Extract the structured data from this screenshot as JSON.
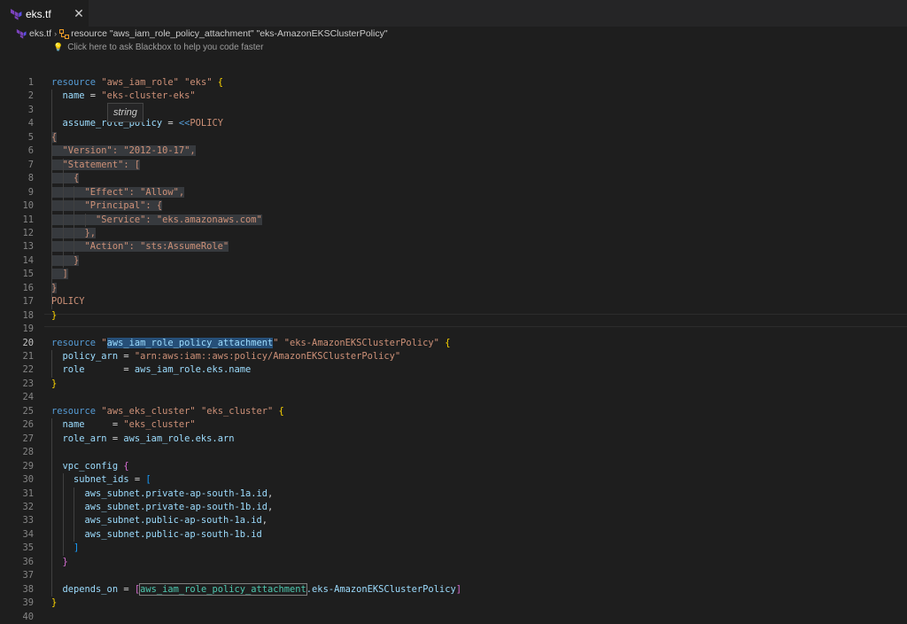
{
  "tab": {
    "label": "eks.tf",
    "close": "✕"
  },
  "breadcrumb": {
    "file": "eks.tf",
    "separator": "›",
    "resource": "resource \"aws_iam_role_policy_attachment\" \"eks-AmazonEKSClusterPolicy\""
  },
  "hint": {
    "text": "Click here to ask Blackbox to help you code faster"
  },
  "tooltip": {
    "text": "string"
  },
  "editor": {
    "active_line": 20,
    "lines": [
      [
        [
          "kw",
          "resource "
        ],
        [
          "str",
          "\"aws_iam_role\""
        ],
        [
          "t",
          " "
        ],
        [
          "str",
          "\"eks\""
        ],
        [
          "t",
          " "
        ],
        [
          "br1",
          "{"
        ]
      ],
      [
        [
          "t",
          "  "
        ],
        [
          "id",
          "name"
        ],
        [
          "t",
          " = "
        ],
        [
          "str",
          "\"eks-cluster-eks\""
        ]
      ],
      [],
      [
        [
          "t",
          "  "
        ],
        [
          "id",
          "assume_role_policy"
        ],
        [
          "t",
          " = "
        ],
        [
          "kw",
          "<<"
        ],
        [
          "str",
          "POLICY"
        ]
      ],
      [
        [
          "str",
          "{"
        ]
      ],
      [
        [
          "str",
          "  \"Version\": \"2012-10-17\","
        ]
      ],
      [
        [
          "str",
          "  \"Statement\": ["
        ]
      ],
      [
        [
          "str",
          "    {"
        ]
      ],
      [
        [
          "str",
          "      \"Effect\": \"Allow\","
        ]
      ],
      [
        [
          "str",
          "      \"Principal\": {"
        ]
      ],
      [
        [
          "str",
          "        \"Service\": \"eks.amazonaws.com\""
        ]
      ],
      [
        [
          "str",
          "      },"
        ]
      ],
      [
        [
          "str",
          "      \"Action\": \"sts:AssumeRole\""
        ]
      ],
      [
        [
          "str",
          "    }"
        ]
      ],
      [
        [
          "str",
          "  ]"
        ]
      ],
      [
        [
          "str",
          "}"
        ]
      ],
      [
        [
          "str",
          "POLICY"
        ]
      ],
      [
        [
          "br1",
          "}"
        ]
      ],
      [],
      [
        [
          "kw",
          "resource "
        ],
        [
          "str",
          "\""
        ],
        [
          "sel",
          "aws_iam_role_policy_attachment"
        ],
        [
          "str",
          "\""
        ],
        [
          "t",
          " "
        ],
        [
          "str",
          "\"eks-AmazonEKSClusterPolicy\""
        ],
        [
          "t",
          " "
        ],
        [
          "br1",
          "{"
        ]
      ],
      [
        [
          "t",
          "  "
        ],
        [
          "id",
          "policy_arn"
        ],
        [
          "t",
          " = "
        ],
        [
          "str",
          "\"arn:aws:iam::aws:policy/AmazonEKSClusterPolicy\""
        ]
      ],
      [
        [
          "t",
          "  "
        ],
        [
          "id",
          "role"
        ],
        [
          "t",
          "       = "
        ],
        [
          "id",
          "aws_iam_role.eks.name"
        ]
      ],
      [
        [
          "br1",
          "}"
        ]
      ],
      [],
      [
        [
          "kw",
          "resource "
        ],
        [
          "str",
          "\"aws_eks_cluster\""
        ],
        [
          "t",
          " "
        ],
        [
          "str",
          "\"eks_cluster\""
        ],
        [
          "t",
          " "
        ],
        [
          "br1",
          "{"
        ]
      ],
      [
        [
          "t",
          "  "
        ],
        [
          "id",
          "name"
        ],
        [
          "t",
          "     = "
        ],
        [
          "str",
          "\"eks_cluster\""
        ]
      ],
      [
        [
          "t",
          "  "
        ],
        [
          "id",
          "role_arn"
        ],
        [
          "t",
          " = "
        ],
        [
          "id",
          "aws_iam_role.eks.arn"
        ]
      ],
      [],
      [
        [
          "t",
          "  "
        ],
        [
          "id",
          "vpc_config"
        ],
        [
          "t",
          " "
        ],
        [
          "br2",
          "{"
        ]
      ],
      [
        [
          "t",
          "    "
        ],
        [
          "id",
          "subnet_ids"
        ],
        [
          "t",
          " = "
        ],
        [
          "br3",
          "["
        ]
      ],
      [
        [
          "t",
          "      "
        ],
        [
          "id",
          "aws_subnet.private-ap-south-1a.id"
        ],
        [
          "t",
          ","
        ]
      ],
      [
        [
          "t",
          "      "
        ],
        [
          "id",
          "aws_subnet.private-ap-south-1b.id"
        ],
        [
          "t",
          ","
        ]
      ],
      [
        [
          "t",
          "      "
        ],
        [
          "id",
          "aws_subnet.public-ap-south-1a.id"
        ],
        [
          "t",
          ","
        ]
      ],
      [
        [
          "t",
          "      "
        ],
        [
          "id",
          "aws_subnet.public-ap-south-1b.id"
        ]
      ],
      [
        [
          "t",
          "    "
        ],
        [
          "br3",
          "]"
        ]
      ],
      [
        [
          "t",
          "  "
        ],
        [
          "br2",
          "}"
        ]
      ],
      [],
      [
        [
          "t",
          "  "
        ],
        [
          "id",
          "depends_on"
        ],
        [
          "t",
          " = "
        ],
        [
          "br2",
          "["
        ],
        [
          "box",
          "aws_iam_role_policy_attachment"
        ],
        [
          "id",
          ".eks-AmazonEKSClusterPolicy"
        ],
        [
          "br2",
          "]"
        ]
      ],
      [
        [
          "br1",
          "}"
        ]
      ],
      []
    ]
  }
}
